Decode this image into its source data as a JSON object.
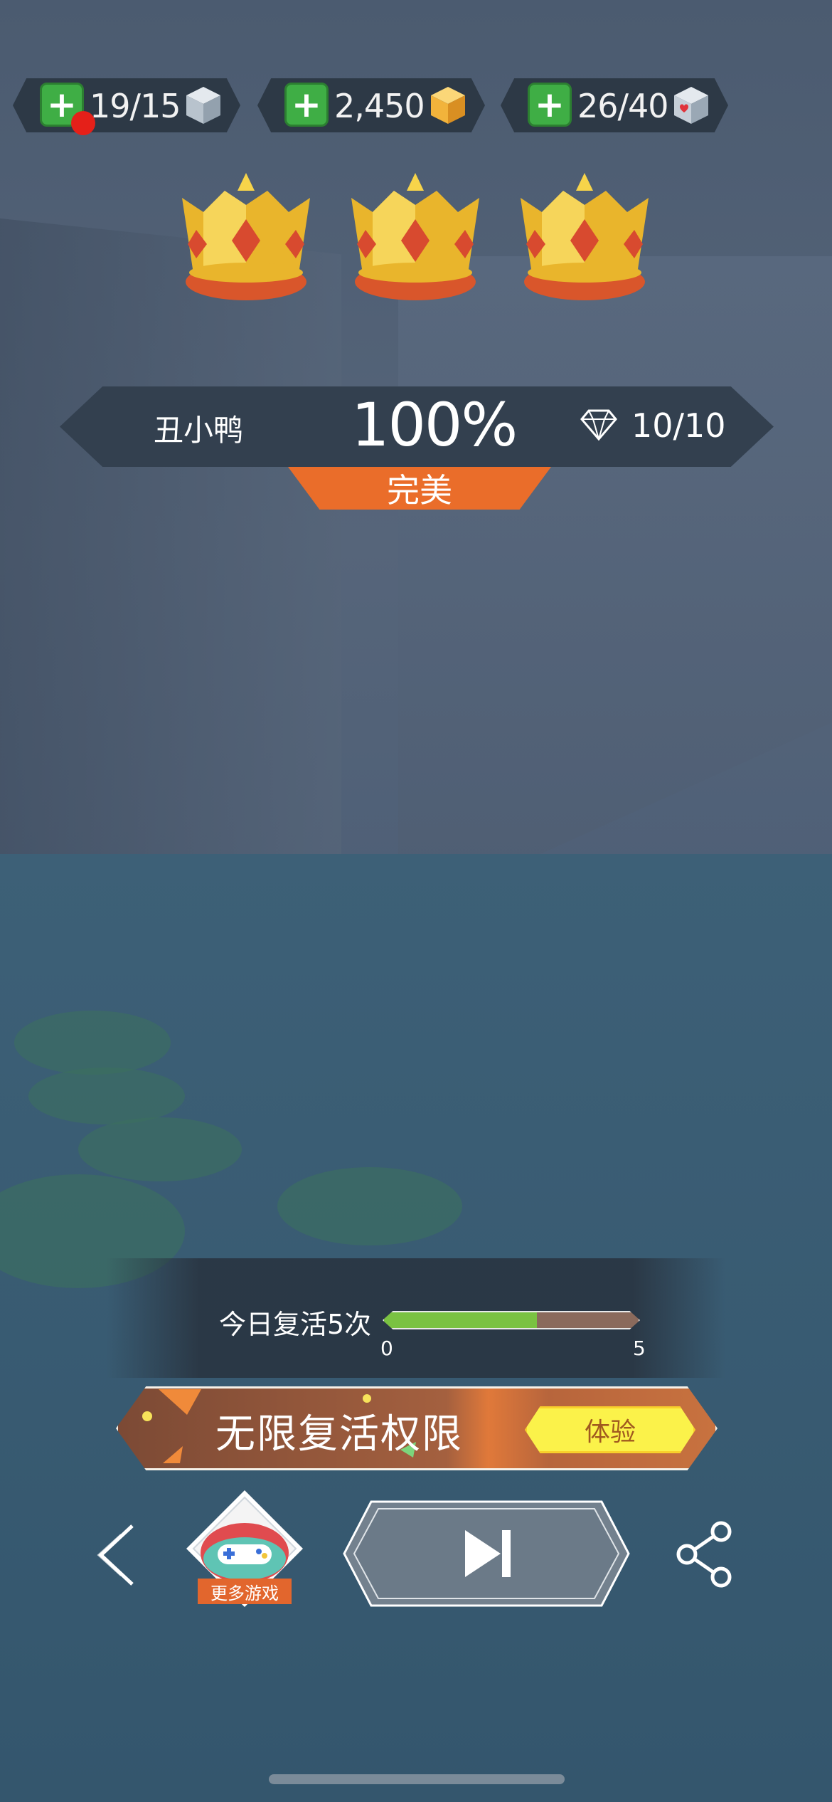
{
  "resources": [
    {
      "value": "19/15",
      "icon": "ice-cube-icon",
      "notification": true
    },
    {
      "value": "2,450",
      "icon": "gold-cube-icon",
      "notification": false
    },
    {
      "value": "26/40",
      "icon": "heart-cube-icon",
      "notification": false
    }
  ],
  "crowns": {
    "earned": 3,
    "total": 3
  },
  "result": {
    "level_name": "丑小鸭",
    "percent": "100%",
    "gems": "10/10",
    "grade": "完美"
  },
  "revive": {
    "label": "今日复活5次",
    "min": "0",
    "max": "5",
    "progress": 0.6
  },
  "promo": {
    "title": "无限复活权限",
    "button": "体验"
  },
  "bottom": {
    "more_games": "更多游戏"
  },
  "colors": {
    "accent_orange": "#ea6d2a",
    "plus_green": "#3fae45",
    "bar_green": "#7ac242",
    "promo_yellow": "#fbf24a",
    "panel_dark": "#33404f"
  }
}
